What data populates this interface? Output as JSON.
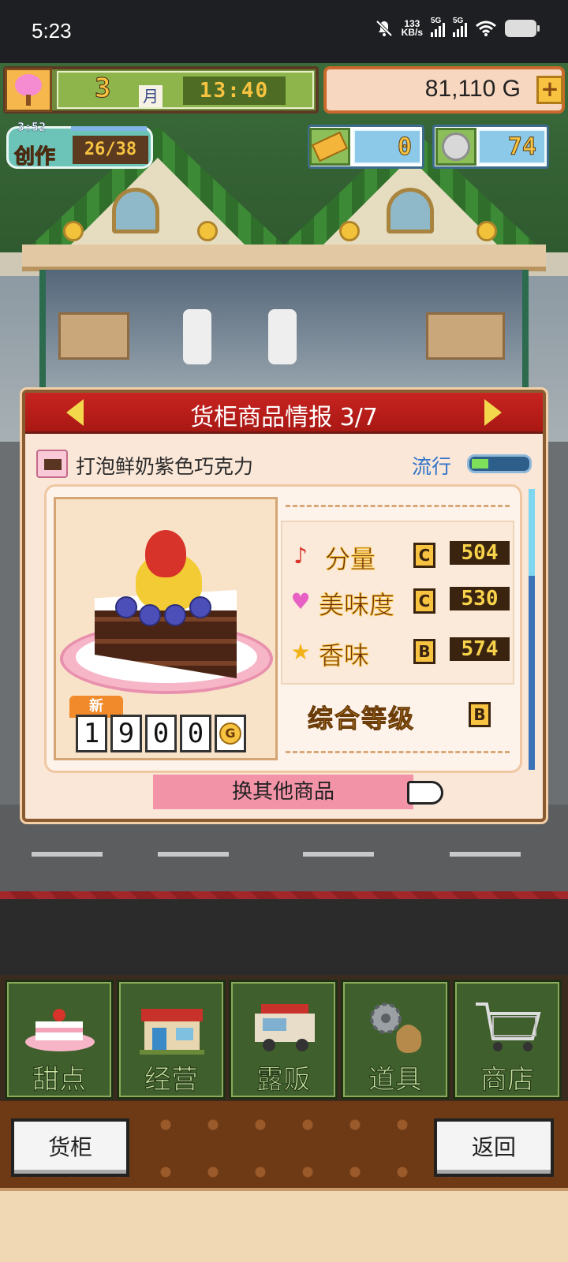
{
  "status_bar": {
    "time": "5:23",
    "net_speed_value": "133",
    "net_speed_unit": "KB/s",
    "sim1": "5G",
    "sim2": "5G",
    "icons": [
      "mute-bell-icon",
      "signal-icon",
      "signal-icon",
      "wifi-icon",
      "battery-icon"
    ]
  },
  "hud": {
    "month_number": "3",
    "month_unit": "月",
    "clock": "13:40",
    "gold": "81,110 G",
    "plus": "+",
    "create_timer": "3:52",
    "create_label": "创作",
    "create_count": "26/38",
    "tickets": "0",
    "medals": "74"
  },
  "dialog": {
    "title": "货柜商品情报 3/7",
    "item_name": "打泡鲜奶紫色巧克力",
    "trend_label": "流行",
    "trend_level": 0.3,
    "new_badge": "新",
    "price_digits": [
      "1",
      "9",
      "0",
      "0"
    ],
    "price_unit": "G",
    "stats": [
      {
        "label": "分量",
        "grade": "C",
        "value": "504",
        "icon": "music-note-icon",
        "icon_char": "♪",
        "color": "#d8332a"
      },
      {
        "label": "美味度",
        "grade": "C",
        "value": "530",
        "icon": "heart-icon",
        "icon_char": "♥",
        "color": "#e760c4"
      },
      {
        "label": "香味",
        "grade": "B",
        "value": "574",
        "icon": "star-icon",
        "icon_char": "★",
        "color": "#f2b21a"
      }
    ],
    "overall_label": "综合等级",
    "overall_grade": "B",
    "change_button": "换其他商品"
  },
  "nav": [
    {
      "label": "甜点",
      "icon": "cake-icon"
    },
    {
      "label": "经营",
      "icon": "shop-icon"
    },
    {
      "label": "露贩",
      "icon": "food-truck-icon"
    },
    {
      "label": "道具",
      "icon": "gear-bag-icon"
    },
    {
      "label": "商店",
      "icon": "cart-icon"
    }
  ],
  "bottom_buttons": {
    "left": "货柜",
    "right": "返回"
  }
}
